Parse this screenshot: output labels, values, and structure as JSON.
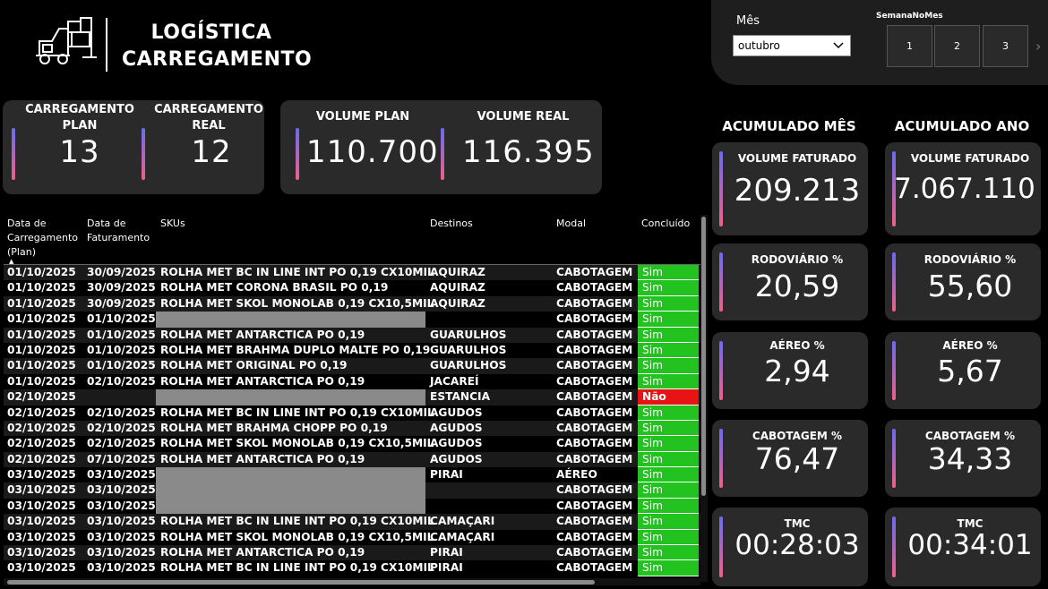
{
  "header": {
    "title_line1": "LOGÍSTICA",
    "title_line2": "CARREGAMENTO"
  },
  "filters": {
    "mes_label": "Mês",
    "mes_selected": "outubro",
    "semana_label": "SemanaNoMes",
    "semanas": [
      "1",
      "2",
      "3"
    ]
  },
  "kpis": {
    "carregamento_plan_label": "CARREGAMENTO PLAN",
    "carregamento_plan_value": "13",
    "carregamento_real_label": "CARREGAMENTO REAL",
    "carregamento_real_value": "12",
    "volume_plan_label": "VOLUME PLAN",
    "volume_plan_value": "110.700",
    "volume_real_label": "VOLUME REAL",
    "volume_real_value": "116.395"
  },
  "acumulado_mes": {
    "heading": "ACUMULADO MÊS",
    "cards": [
      {
        "label": "VOLUME FATURADO",
        "value": "209.213"
      },
      {
        "label": "RODOVIÁRIO %",
        "value": "20,59"
      },
      {
        "label": "AÉREO %",
        "value": "2,94"
      },
      {
        "label": "CABOTAGEM %",
        "value": "76,47"
      },
      {
        "label": "TMC",
        "value": "00:28:03"
      }
    ]
  },
  "acumulado_ano": {
    "heading": "ACUMULADO ANO",
    "cards": [
      {
        "label": "VOLUME FATURADO",
        "value": "7.067.110"
      },
      {
        "label": "RODOVIÁRIO %",
        "value": "55,60"
      },
      {
        "label": "AÉREO %",
        "value": "5,67"
      },
      {
        "label": "CABOTAGEM %",
        "value": "34,33"
      },
      {
        "label": "TMC",
        "value": "00:34:01"
      }
    ]
  },
  "table": {
    "columns": [
      "Data de Carregamento (Plan)",
      "Data de Faturamento",
      "SKUs",
      "Destinos",
      "Modal",
      "Concluído"
    ],
    "rows": [
      [
        "01/10/2025",
        "30/09/2025",
        "ROLHA MET BC IN LINE INT PO 0,19 CX10MIL",
        "AQUIRAZ",
        "CABOTAGEM",
        "Sim"
      ],
      [
        "01/10/2025",
        "30/09/2025",
        "ROLHA MET CORONA BRASIL PO 0,19",
        "AQUIRAZ",
        "CABOTAGEM",
        "Sim"
      ],
      [
        "01/10/2025",
        "30/09/2025",
        "ROLHA MET SKOL MONOLAB 0,19 CX10,5MIL",
        "AQUIRAZ",
        "CABOTAGEM",
        "Sim"
      ],
      [
        "01/10/2025",
        "01/10/2025",
        "",
        "",
        "CABOTAGEM",
        "Sim"
      ],
      [
        "01/10/2025",
        "01/10/2025",
        "ROLHA MET ANTARCTICA PO 0,19",
        "GUARULHOS",
        "CABOTAGEM",
        "Sim"
      ],
      [
        "01/10/2025",
        "01/10/2025",
        "ROLHA MET BRAHMA DUPLO MALTE PO 0,19",
        "GUARULHOS",
        "CABOTAGEM",
        "Sim"
      ],
      [
        "01/10/2025",
        "01/10/2025",
        "ROLHA MET ORIGINAL PO 0,19",
        "GUARULHOS",
        "CABOTAGEM",
        "Sim"
      ],
      [
        "01/10/2025",
        "02/10/2025",
        "ROLHA MET ANTARCTICA PO 0,19",
        "JACAREÍ",
        "CABOTAGEM",
        "Sim"
      ],
      [
        "02/10/2025",
        "",
        "",
        "ESTANCIA",
        "CABOTAGEM",
        "Não"
      ],
      [
        "02/10/2025",
        "02/10/2025",
        "ROLHA MET BC IN LINE INT PO 0,19 CX10MIL",
        "AGUDOS",
        "CABOTAGEM",
        "Sim"
      ],
      [
        "02/10/2025",
        "02/10/2025",
        "ROLHA MET BRAHMA CHOPP PO 0,19",
        "AGUDOS",
        "CABOTAGEM",
        "Sim"
      ],
      [
        "02/10/2025",
        "02/10/2025",
        "ROLHA MET SKOL MONOLAB 0,19 CX10,5MIL",
        "AGUDOS",
        "CABOTAGEM",
        "Sim"
      ],
      [
        "02/10/2025",
        "07/10/2025",
        "ROLHA MET ANTARCTICA PO 0,19",
        "AGUDOS",
        "CABOTAGEM",
        "Sim"
      ],
      [
        "03/10/2025",
        "03/10/2025",
        "",
        "PIRAI",
        "AÉREO",
        "Sim"
      ],
      [
        "03/10/2025",
        "03/10/2025",
        "",
        "",
        "CABOTAGEM",
        "Sim"
      ],
      [
        "03/10/2025",
        "03/10/2025",
        "",
        "",
        "CABOTAGEM",
        "Sim"
      ],
      [
        "03/10/2025",
        "03/10/2025",
        "ROLHA MET BC IN LINE INT PO 0,19 CX10MIL",
        "CAMAÇARI",
        "CABOTAGEM",
        "Sim"
      ],
      [
        "03/10/2025",
        "03/10/2025",
        "ROLHA MET SKOL MONOLAB 0,19 CX10,5MIL",
        "CAMAÇARI",
        "CABOTAGEM",
        "Sim"
      ],
      [
        "03/10/2025",
        "03/10/2025",
        "ROLHA MET ANTARCTICA PO 0,19",
        "PIRAI",
        "CABOTAGEM",
        "Sim"
      ],
      [
        "03/10/2025",
        "03/10/2025",
        "ROLHA MET BC IN LINE INT PO 0,19 CX10MIL",
        "PIRAI",
        "CABOTAGEM",
        "Sim"
      ]
    ]
  },
  "colors": {
    "sim": "#22c21f",
    "nao": "#e81313",
    "card_bg": "#2a2a2a",
    "gradient_top": "#6b6bf0",
    "gradient_bottom": "#f0608a"
  }
}
